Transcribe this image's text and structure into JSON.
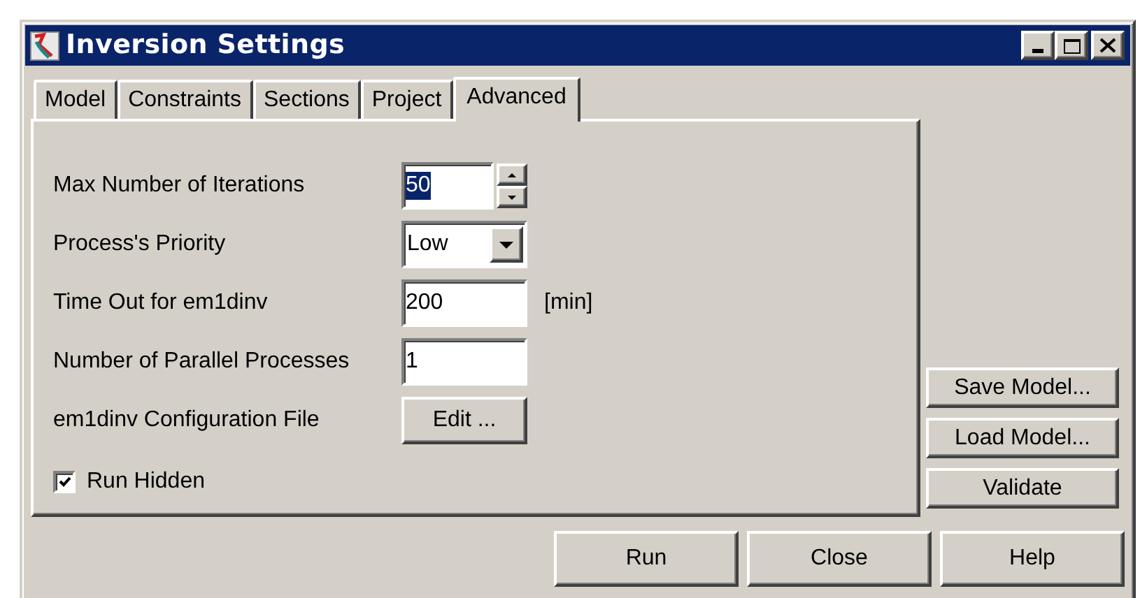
{
  "window": {
    "title": "Inversion Settings"
  },
  "tabs": [
    {
      "label": "Model",
      "selected": false
    },
    {
      "label": "Constraints",
      "selected": false
    },
    {
      "label": "Sections",
      "selected": false
    },
    {
      "label": "Project",
      "selected": false
    },
    {
      "label": "Advanced",
      "selected": true
    }
  ],
  "fields": [
    {
      "kind": "spin",
      "label": "Max Number of Iterations",
      "value": "50",
      "highlighted": true
    },
    {
      "kind": "dropdown",
      "label": "Process's Priority",
      "value": "Low"
    },
    {
      "kind": "text",
      "label": "Time Out for em1dinv",
      "value": "200",
      "unit": "[min]"
    },
    {
      "kind": "text",
      "label": "Number of Parallel Processes",
      "value": "1"
    },
    {
      "kind": "button",
      "label": "em1dinv Configuration File",
      "value": "Edit ..."
    }
  ],
  "run_hidden": {
    "label": "Run Hidden",
    "checked": true
  },
  "side_buttons": [
    "Save Model...",
    "Load Model...",
    "Validate"
  ],
  "buttons": [
    "Run",
    "Close",
    "Help"
  ]
}
